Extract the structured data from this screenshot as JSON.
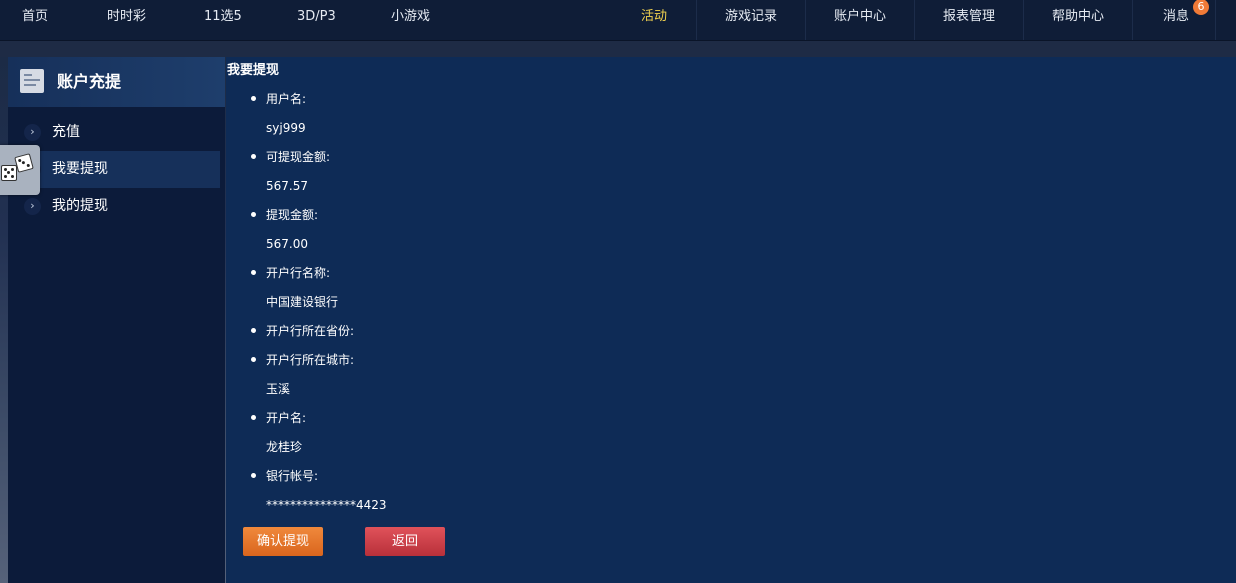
{
  "nav": {
    "left": [
      "首页",
      "时时彩",
      "11选5",
      "3D/P3",
      "小游戏"
    ],
    "right": [
      "活动",
      "游戏记录",
      "账户中心",
      "报表管理",
      "帮助中心",
      "消息"
    ],
    "message_badge": "6",
    "active_color": "#f2d24f"
  },
  "sidebar": {
    "title": "账户充提",
    "items": [
      {
        "label": "充值",
        "icon": "chevron-right-icon"
      },
      {
        "label": "我要提现",
        "icon": "chevron-right-icon",
        "active": true
      },
      {
        "label": "我的提现",
        "icon": "chevron-right-icon"
      }
    ]
  },
  "main": {
    "heading": "我要提现",
    "fields": [
      {
        "label": "用户名:",
        "value": "syj999"
      },
      {
        "label": "可提现金额:",
        "value": "567.57"
      },
      {
        "label": "提现金额:",
        "value": "567.00"
      },
      {
        "label": "开户行名称:",
        "value": "中国建设银行"
      },
      {
        "label": "开户行所在省份:",
        "value": ""
      },
      {
        "label": "开户行所在城市:",
        "value": "玉溪"
      },
      {
        "label": "开户名:",
        "value": "龙桂珍"
      },
      {
        "label": "银行帐号:",
        "value": "***************4423"
      }
    ],
    "confirm_label": "确认提现",
    "back_label": "返回"
  }
}
